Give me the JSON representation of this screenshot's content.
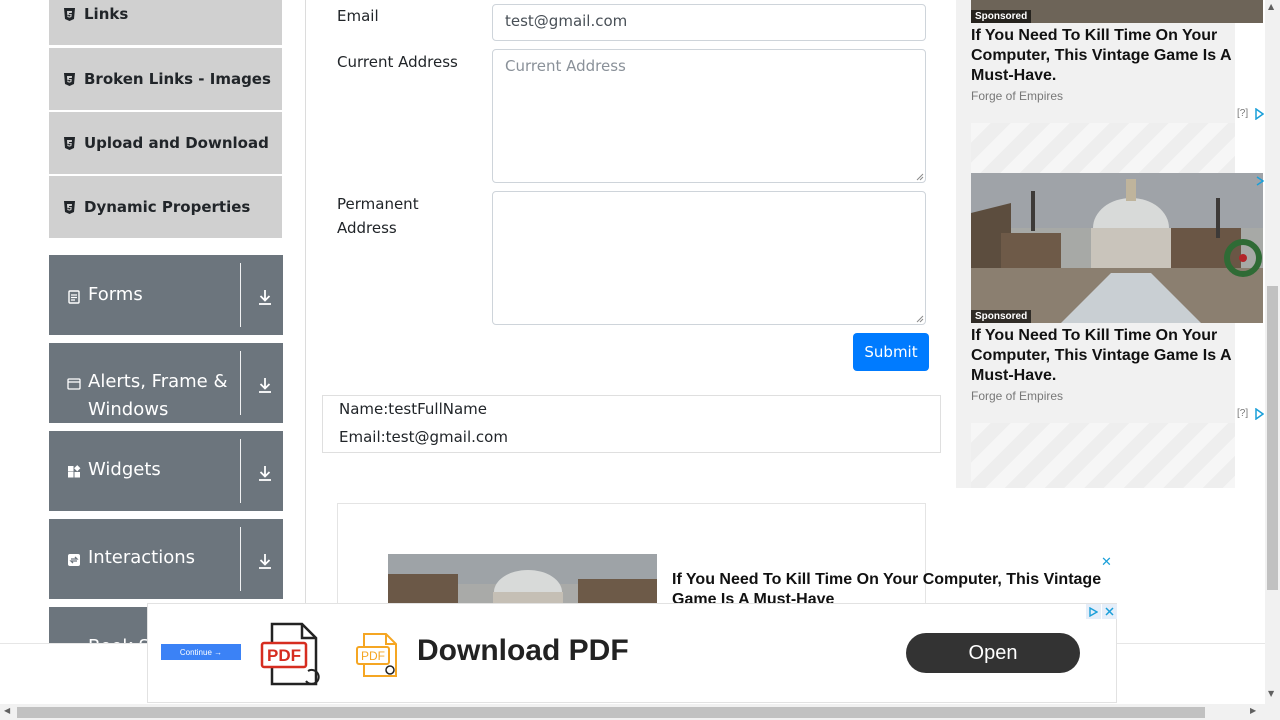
{
  "sidebar": {
    "sub_items": [
      {
        "label": "Links"
      },
      {
        "label": "Broken Links - Images"
      },
      {
        "label": "Upload and Download"
      },
      {
        "label": "Dynamic Properties"
      }
    ],
    "groups": [
      {
        "label": "Forms",
        "icon": "form-icon"
      },
      {
        "label_line1": "Alerts, Frame &",
        "label_line2": "Windows",
        "icon": "window-icon"
      },
      {
        "label": "Widgets",
        "icon": "widgets-icon"
      },
      {
        "label": "Interactions",
        "icon": "interactions-icon"
      },
      {
        "label": "Book Store Application",
        "icon": "book-icon"
      }
    ]
  },
  "form": {
    "email_label": "Email",
    "email_value": "test@gmail.com",
    "current_address_label": "Current Address",
    "current_address_placeholder": "Current Address",
    "permanent_address_label_line1": "Permanent",
    "permanent_address_label_line2": "Address",
    "submit_label": "Submit"
  },
  "output": {
    "name": "Name:testFullName",
    "email": "Email:test@gmail.com"
  },
  "ads": {
    "sponsored_label": "Sponsored",
    "title": "If You Need To Kill Time On Your Computer, This Vintage Game Is A Must-Have.",
    "source": "Forge of Empires",
    "help": "[?]",
    "inline_title": "If You Need To Kill Time On Your Computer, This Vintage Game Is A Must-Have",
    "close": "✕"
  },
  "banner": {
    "continue_label": "Continue →",
    "pdf_label": "PDF",
    "title": "Download PDF",
    "open_label": "Open"
  },
  "colors": {
    "sidebar_group_bg": "#6c757d",
    "sidebar_sub_bg": "#d0d0d0",
    "primary": "#007bff"
  }
}
